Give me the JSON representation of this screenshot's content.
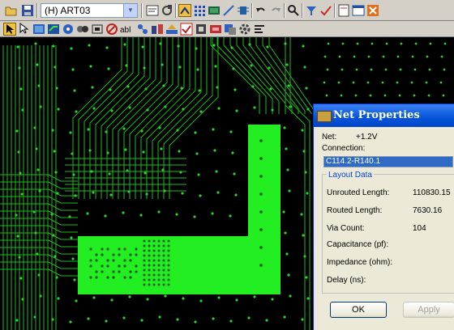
{
  "toolbar_top": {
    "layer_select_value": "(H) ART03",
    "icons_left": [
      "open-folder-icon",
      "save-disk-icon"
    ],
    "icons_right": [
      "properties-icon",
      "refresh-icon",
      "route-mode-icon",
      "grid-icon",
      "layer-icon",
      "route-line-icon",
      "pins-icon",
      "undo-icon",
      "redo-icon",
      "zoom-icon",
      "filter-icon",
      "check-icon",
      "report-icon",
      "window-icon",
      "exit-icon"
    ]
  },
  "toolbar_bottom": {
    "icons": [
      "select-arrow-icon",
      "design-arrow-icon",
      "board-icon",
      "trace-icon",
      "via-icon",
      "drill-icon",
      "copper-icon",
      "no-icon",
      "text-icon",
      "netlist-icon",
      "components-icon",
      "highlight-icon",
      "drc-icon",
      "dimension-icon",
      "pour-icon",
      "plane-icon",
      "settings-icon",
      "menu-icon"
    ]
  },
  "colors": {
    "trace": "#20c020",
    "pour": "#22ee22",
    "via": "#30d030",
    "background": "#000000",
    "dialog": "#ece9d8",
    "title": "#0553d8",
    "selection": "#316ac5"
  },
  "dialog": {
    "title": "Net Properties",
    "net_label": "Net:",
    "net_value": "+1.2V",
    "connection_label": "Connection:",
    "connection_value": "C114.2-R140.1",
    "layout_group_title": "Layout Data",
    "rows": [
      {
        "label": "Unrouted Length:",
        "value": "110830.15"
      },
      {
        "label": "Routed Length:",
        "value": "7630.16"
      },
      {
        "label": "Via Count:",
        "value": "104"
      },
      {
        "label": "Capacitance (pf):",
        "value": ""
      },
      {
        "label": "Impedance (ohm):",
        "value": ""
      },
      {
        "label": "Delay (ns):",
        "value": ""
      }
    ],
    "ok_label": "OK",
    "apply_label": "Apply"
  }
}
